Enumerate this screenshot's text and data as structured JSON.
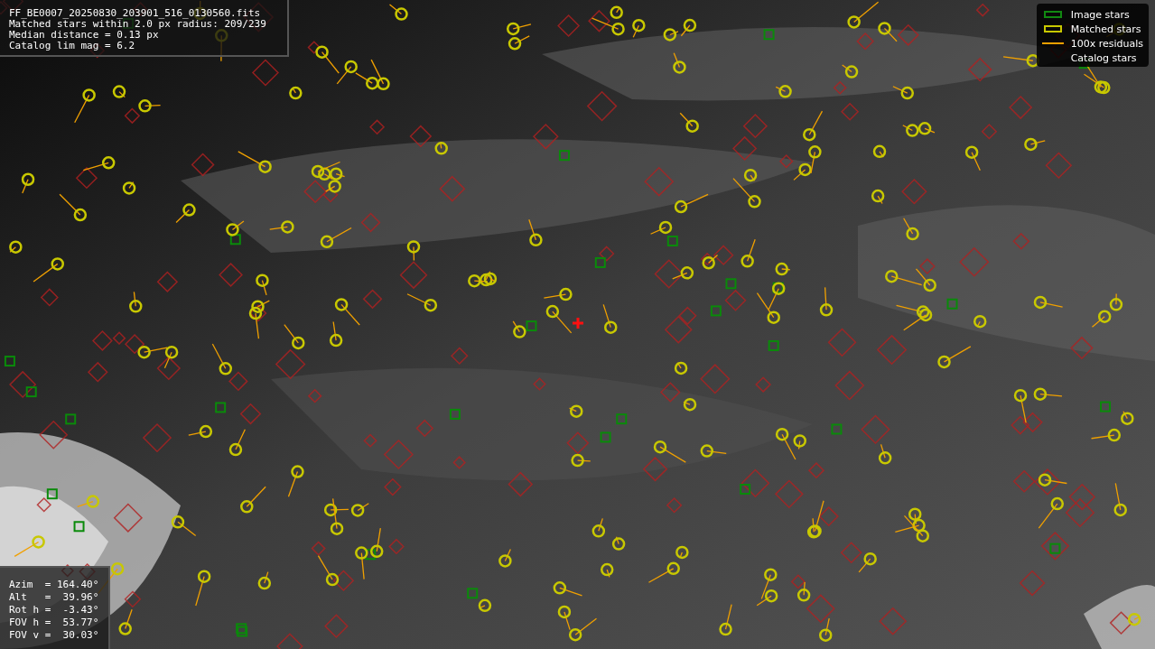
{
  "header": {
    "lines": [
      "FF_BE0007_20250830_203901_516_0130560.fits",
      "Matched stars within 2.0 px radius: 209/239",
      "Median distance = 0.13 px",
      "Catalog lim mag = 6.2"
    ]
  },
  "legend": [
    {
      "label": "Image stars"
    },
    {
      "kind": "matched",
      "label": "Matched stars"
    },
    {
      "kind": "residual",
      "label": "100x residuals"
    },
    {
      "kind": "catalog",
      "label": "Catalog stars"
    }
  ],
  "pointing": {
    "lines": [
      "Azim  = 164.40°",
      "Alt   =  39.96°",
      "Rot h =  -3.43°",
      "FOV h =  53.77°",
      "FOV v =  30.03°"
    ]
  }
}
